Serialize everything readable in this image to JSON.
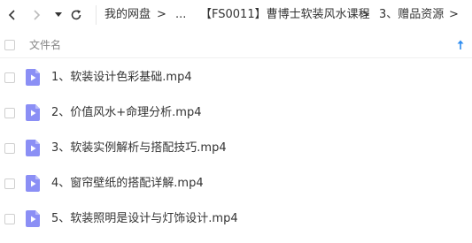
{
  "nav": {
    "back_icon": "chevron-left-icon",
    "forward_icon": "chevron-right-icon",
    "history_dropdown_icon": "caret-down-icon",
    "refresh_icon": "refresh-icon",
    "separator": ">",
    "breadcrumbs": [
      "我的网盘",
      "...",
      "【FS0011】曹博士软装风水课程",
      "3、赠品资源"
    ]
  },
  "list": {
    "column_name": "文件名",
    "sort_icon": "sort-ascending-icon",
    "file_icon": "video-file-icon",
    "files": [
      "1、软装设计色彩基础.mp4",
      "2、价值风水+命理分析.mp4",
      "3、软装实例解析与搭配技巧.mp4",
      "4、窗帘壁纸的搭配详解.mp4",
      "5、软装照明是设计与灯饰设计.mp4"
    ]
  },
  "colors": {
    "accent": "#2d8cf0",
    "file_icon": "#8b8ff5",
    "text": "#333333",
    "muted": "#888888"
  }
}
